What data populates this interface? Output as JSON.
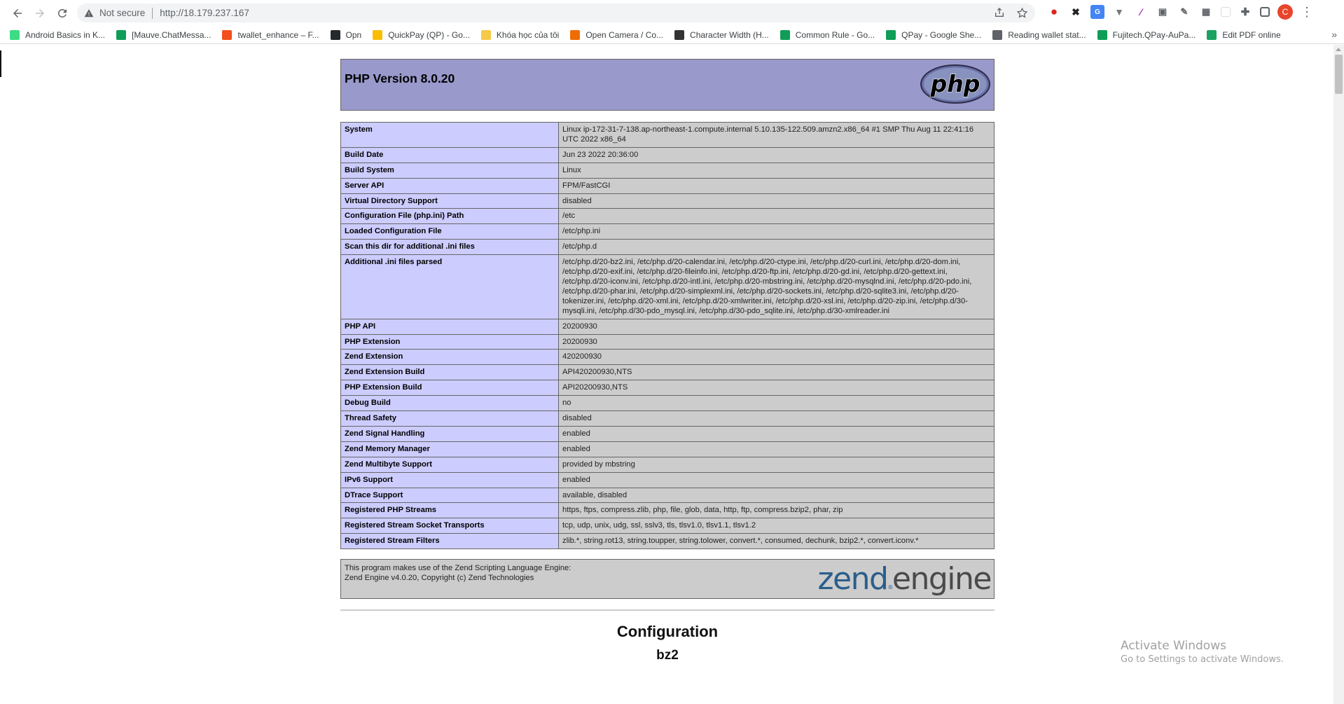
{
  "browser": {
    "security_label": "Not secure",
    "url": "http://18.179.237.167",
    "profile_initial": "C"
  },
  "bookmarks": [
    {
      "label": "Android Basics in K...",
      "icon": "android-icon",
      "color": "#3ddc84"
    },
    {
      "label": "[Mauve.ChatMessa...",
      "icon": "sheets-icon",
      "color": "#0f9d58"
    },
    {
      "label": "twallet_enhance – F...",
      "icon": "figma-icon",
      "color": "#f24e1e"
    },
    {
      "label": "Opn",
      "icon": "github-icon",
      "color": "#24292e"
    },
    {
      "label": "QuickPay (QP) - Go...",
      "icon": "drive-icon",
      "color": "#fbbc04"
    },
    {
      "label": "Khóa học của tôi",
      "icon": "course-icon",
      "color": "#f7c948"
    },
    {
      "label": "Open Camera / Co...",
      "icon": "camera-icon",
      "color": "#ef6c00"
    },
    {
      "label": "Character Width (H...",
      "icon": "d-icon",
      "color": "#333333"
    },
    {
      "label": "Common Rule - Go...",
      "icon": "sheets-icon",
      "color": "#0f9d58"
    },
    {
      "label": "QPay - Google She...",
      "icon": "sheets-icon",
      "color": "#0f9d58"
    },
    {
      "label": "Reading wallet stat...",
      "icon": "code-icon",
      "color": "#5f6368"
    },
    {
      "label": "Fujitech.QPay-AuPa...",
      "icon": "sheets-icon",
      "color": "#0f9d58"
    },
    {
      "label": "Edit PDF online",
      "icon": "pdf-icon",
      "color": "#1aa260"
    }
  ],
  "phpinfo": {
    "title": "PHP Version 8.0.20",
    "rows": [
      {
        "key": "System",
        "value": "Linux ip-172-31-7-138.ap-northeast-1.compute.internal 5.10.135-122.509.amzn2.x86_64 #1 SMP Thu Aug 11 22:41:16 UTC 2022 x86_64"
      },
      {
        "key": "Build Date",
        "value": "Jun 23 2022 20:36:00"
      },
      {
        "key": "Build System",
        "value": "Linux"
      },
      {
        "key": "Server API",
        "value": "FPM/FastCGI"
      },
      {
        "key": "Virtual Directory Support",
        "value": "disabled"
      },
      {
        "key": "Configuration File (php.ini) Path",
        "value": "/etc"
      },
      {
        "key": "Loaded Configuration File",
        "value": "/etc/php.ini"
      },
      {
        "key": "Scan this dir for additional .ini files",
        "value": "/etc/php.d"
      },
      {
        "key": "Additional .ini files parsed",
        "value": "/etc/php.d/20-bz2.ini, /etc/php.d/20-calendar.ini, /etc/php.d/20-ctype.ini, /etc/php.d/20-curl.ini, /etc/php.d/20-dom.ini, /etc/php.d/20-exif.ini, /etc/php.d/20-fileinfo.ini, /etc/php.d/20-ftp.ini, /etc/php.d/20-gd.ini, /etc/php.d/20-gettext.ini, /etc/php.d/20-iconv.ini, /etc/php.d/20-intl.ini, /etc/php.d/20-mbstring.ini, /etc/php.d/20-mysqlnd.ini, /etc/php.d/20-pdo.ini, /etc/php.d/20-phar.ini, /etc/php.d/20-simplexml.ini, /etc/php.d/20-sockets.ini, /etc/php.d/20-sqlite3.ini, /etc/php.d/20-tokenizer.ini, /etc/php.d/20-xml.ini, /etc/php.d/20-xmlwriter.ini, /etc/php.d/20-xsl.ini, /etc/php.d/20-zip.ini, /etc/php.d/30-mysqli.ini, /etc/php.d/30-pdo_mysql.ini, /etc/php.d/30-pdo_sqlite.ini, /etc/php.d/30-xmlreader.ini"
      },
      {
        "key": "PHP API",
        "value": "20200930"
      },
      {
        "key": "PHP Extension",
        "value": "20200930"
      },
      {
        "key": "Zend Extension",
        "value": "420200930"
      },
      {
        "key": "Zend Extension Build",
        "value": "API420200930,NTS"
      },
      {
        "key": "PHP Extension Build",
        "value": "API20200930,NTS"
      },
      {
        "key": "Debug Build",
        "value": "no"
      },
      {
        "key": "Thread Safety",
        "value": "disabled"
      },
      {
        "key": "Zend Signal Handling",
        "value": "enabled"
      },
      {
        "key": "Zend Memory Manager",
        "value": "enabled"
      },
      {
        "key": "Zend Multibyte Support",
        "value": "provided by mbstring"
      },
      {
        "key": "IPv6 Support",
        "value": "enabled"
      },
      {
        "key": "DTrace Support",
        "value": "available, disabled"
      },
      {
        "key": "Registered PHP Streams",
        "value": "https, ftps, compress.zlib, php, file, glob, data, http, ftp, compress.bzip2, phar, zip"
      },
      {
        "key": "Registered Stream Socket Transports",
        "value": "tcp, udp, unix, udg, ssl, sslv3, tls, tlsv1.0, tlsv1.1, tlsv1.2"
      },
      {
        "key": "Registered Stream Filters",
        "value": "zlib.*, string.rot13, string.toupper, string.tolower, convert.*, consumed, dechunk, bzip2.*, convert.iconv.*"
      }
    ],
    "zend_line1": "This program makes use of the Zend Scripting Language Engine:",
    "zend_line2": "Zend Engine v4.0.20, Copyright (c) Zend Technologies",
    "zend_logo_part1": "zend",
    "zend_logo_part2": "engine",
    "php_logo_text": "php",
    "config_heading": "Configuration",
    "module_heading": "bz2"
  },
  "watermark": {
    "line1": "Activate Windows",
    "line2": "Go to Settings to activate Windows."
  },
  "colors": {
    "header_bg": "#9999cc",
    "key_bg": "#ccccff",
    "value_bg": "#cccccc"
  }
}
